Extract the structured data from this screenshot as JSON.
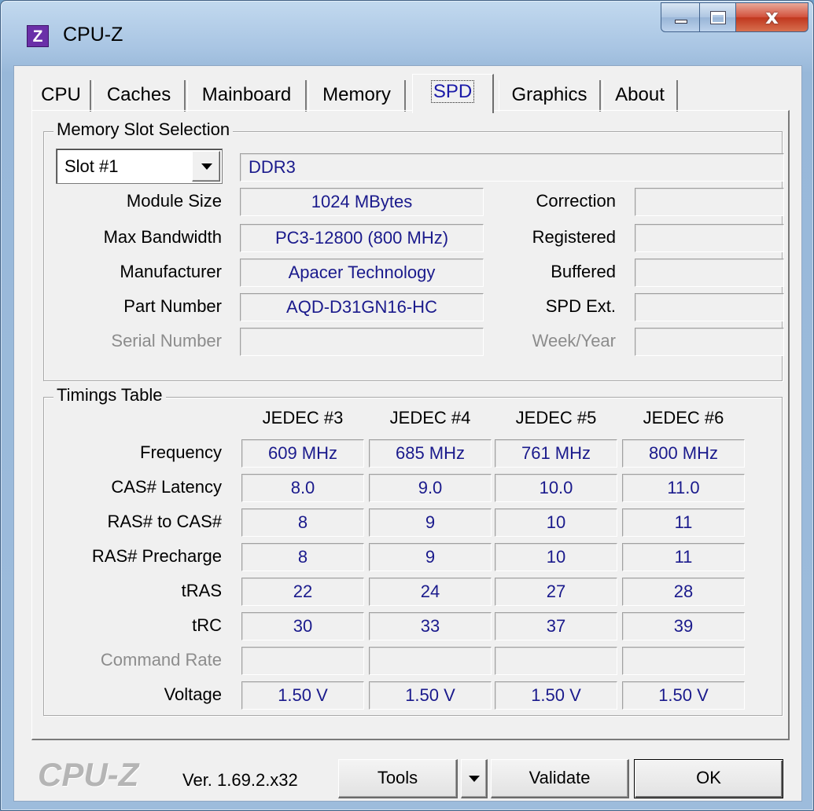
{
  "window": {
    "title": "CPU-Z",
    "icon_letter": "Z",
    "close_glyph": "x"
  },
  "tabs": [
    {
      "label": "CPU"
    },
    {
      "label": "Caches"
    },
    {
      "label": "Mainboard"
    },
    {
      "label": "Memory"
    },
    {
      "label": "SPD",
      "active": true
    },
    {
      "label": "Graphics"
    },
    {
      "label": "About"
    }
  ],
  "slot_group": {
    "title": "Memory Slot Selection",
    "slot_selected": "Slot #1",
    "memory_type": "DDR3",
    "module_size_label": "Module Size",
    "module_size": "1024 MBytes",
    "max_bandwidth_label": "Max Bandwidth",
    "max_bandwidth": "PC3-12800 (800 MHz)",
    "manufacturer_label": "Manufacturer",
    "manufacturer": "Apacer Technology",
    "part_number_label": "Part Number",
    "part_number": "AQD-D31GN16-HC",
    "serial_number_label": "Serial Number",
    "serial_number": "",
    "correction_label": "Correction",
    "correction": "",
    "registered_label": "Registered",
    "registered": "",
    "buffered_label": "Buffered",
    "buffered": "",
    "spd_ext_label": "SPD Ext.",
    "spd_ext": "",
    "week_year_label": "Week/Year",
    "week_year": ""
  },
  "timings": {
    "title": "Timings Table",
    "columns": [
      "JEDEC #3",
      "JEDEC #4",
      "JEDEC #5",
      "JEDEC #6"
    ],
    "rows": [
      {
        "label": "Frequency",
        "values": [
          "609 MHz",
          "685 MHz",
          "761 MHz",
          "800 MHz"
        ]
      },
      {
        "label": "CAS# Latency",
        "values": [
          "8.0",
          "9.0",
          "10.0",
          "11.0"
        ]
      },
      {
        "label": "RAS# to CAS#",
        "values": [
          "8",
          "9",
          "10",
          "11"
        ]
      },
      {
        "label": "RAS# Precharge",
        "values": [
          "8",
          "9",
          "10",
          "11"
        ]
      },
      {
        "label": "tRAS",
        "values": [
          "22",
          "24",
          "27",
          "28"
        ]
      },
      {
        "label": "tRC",
        "values": [
          "30",
          "33",
          "37",
          "39"
        ]
      },
      {
        "label": "Command Rate",
        "values": [
          "",
          "",
          "",
          ""
        ],
        "dim": true
      },
      {
        "label": "Voltage",
        "values": [
          "1.50 V",
          "1.50 V",
          "1.50 V",
          "1.50 V"
        ]
      }
    ]
  },
  "footer": {
    "brand": "CPU-Z",
    "version": "Ver. 1.69.2.x32",
    "tools_label": "Tools",
    "validate_label": "Validate",
    "ok_label": "OK"
  }
}
